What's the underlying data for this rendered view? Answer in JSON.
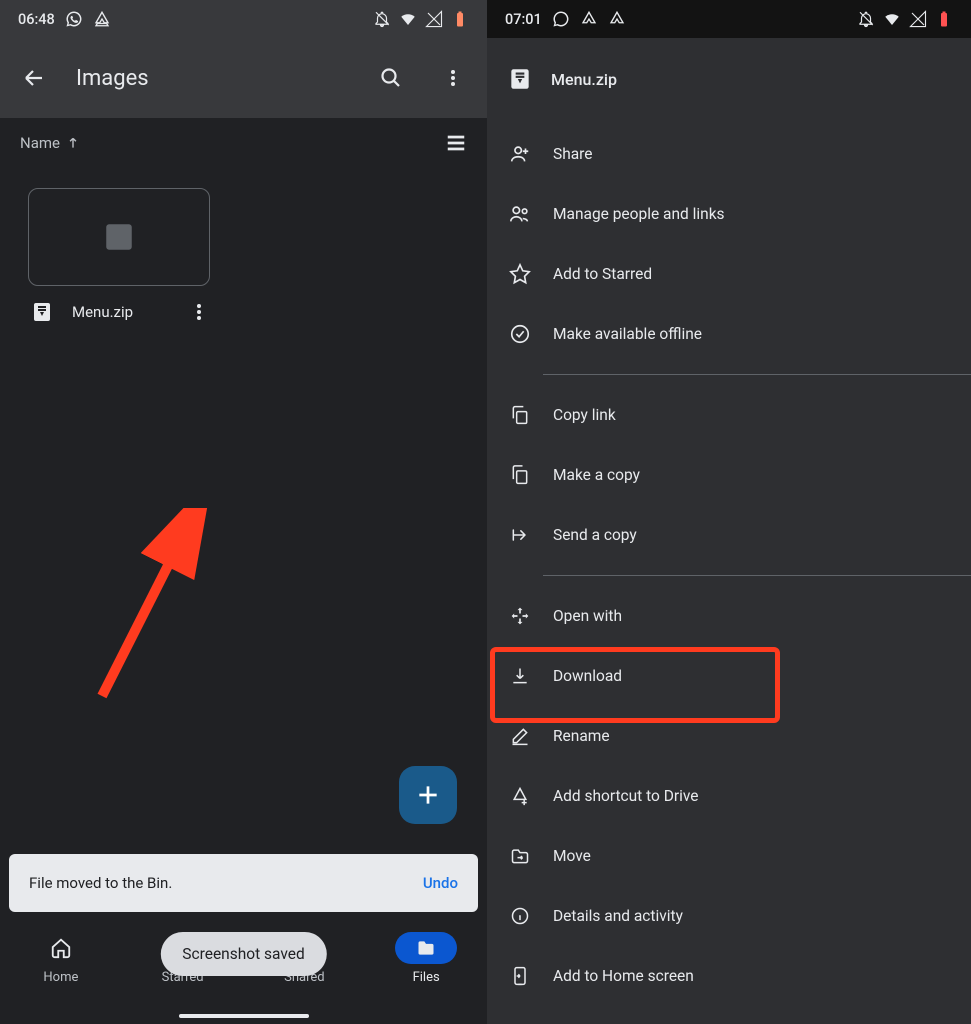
{
  "left": {
    "status": {
      "time": "06:48"
    },
    "topbar": {
      "title": "Images"
    },
    "sort": {
      "label": "Name"
    },
    "file": {
      "name": "Menu.zip"
    },
    "snackbar": {
      "message": "File moved to the Bin.",
      "action": "Undo"
    },
    "toast": "Screenshot saved",
    "nav": {
      "home": "Home",
      "starred": "Starred",
      "shared": "Shared",
      "files": "Files"
    }
  },
  "right": {
    "status": {
      "time": "07:01"
    },
    "file": {
      "name": "Menu.zip"
    },
    "menu": {
      "share": "Share",
      "manage": "Manage people and links",
      "star": "Add to Starred",
      "offline": "Make available offline",
      "copylink": "Copy link",
      "makecopy": "Make a copy",
      "sendcopy": "Send a copy",
      "openwith": "Open with",
      "download": "Download",
      "rename": "Rename",
      "shortcut": "Add shortcut to Drive",
      "move": "Move",
      "details": "Details and activity",
      "homescreen": "Add to Home screen"
    }
  }
}
